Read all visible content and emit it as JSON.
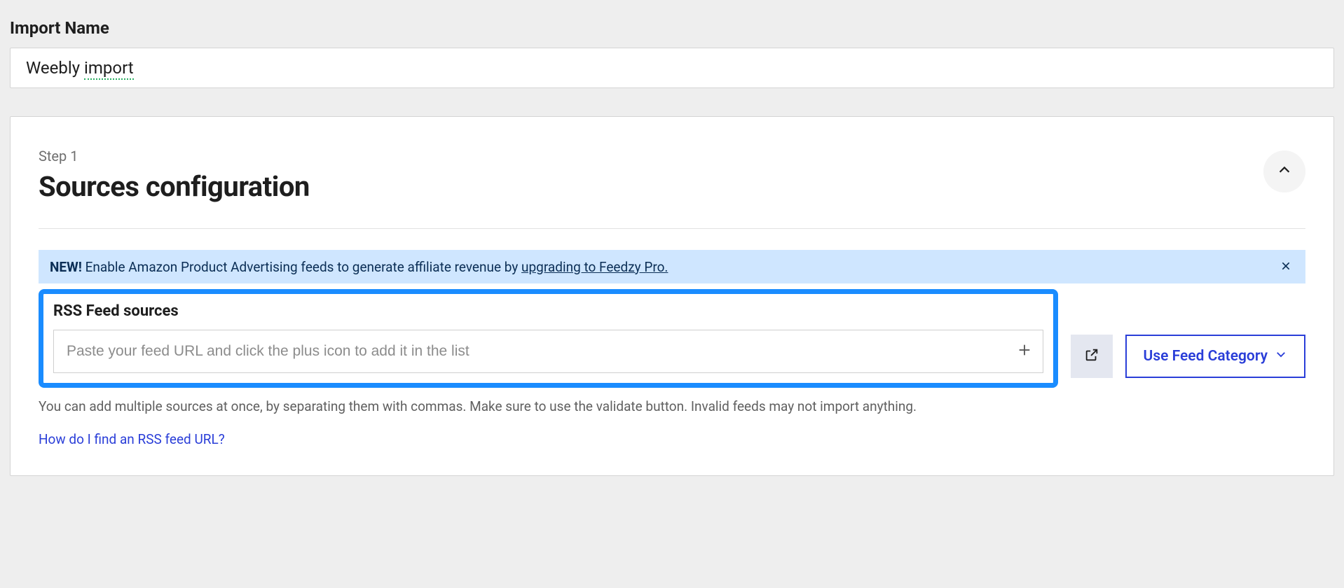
{
  "importName": {
    "label": "Import Name",
    "value_pre": "Weebly ",
    "value_word": "import"
  },
  "step": {
    "label": "Step 1",
    "title": "Sources configuration"
  },
  "banner": {
    "badge": "NEW!",
    "text_before": " Enable Amazon Product Advertising feeds to generate affiliate revenue by ",
    "link_text": "upgrading to Feedzy Pro."
  },
  "rss": {
    "label": "RSS Feed sources",
    "placeholder": "Paste your feed URL and click the plus icon to add it in the list",
    "value": ""
  },
  "categoryButton": "Use Feed Category",
  "helper": "You can add multiple sources at once, by separating them with commas. Make sure to use the validate button. Invalid feeds may not import anything.",
  "helpLink": "How do I find an RSS feed URL?"
}
